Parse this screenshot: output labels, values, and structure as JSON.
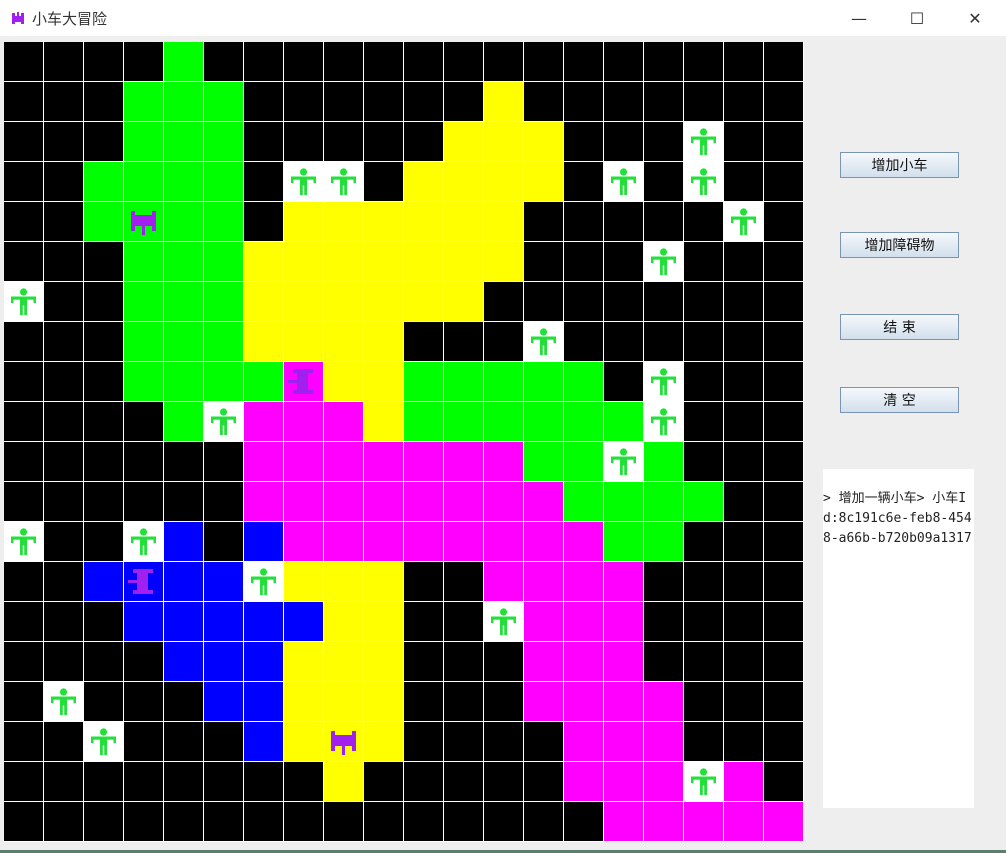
{
  "window": {
    "title": "小车大冒险",
    "controls": {
      "minimize": "—",
      "maximize": "☐",
      "close": "✕"
    }
  },
  "colors": {
    "K": "#000000",
    "G": "#00ff00",
    "Y": "#ffff00",
    "M": "#ff00ff",
    "B": "#0000ff",
    "W": "#ffffff",
    "person": "#22e03a",
    "car": "#a020f0"
  },
  "grid": {
    "rows": 20,
    "cols": 20,
    "cells": [
      "KKKKGKKKKKKKKKKKKKKK",
      "KKKGGGKKKKKKYKKKKKKK",
      "KKKGGGKKKKKYYYKKKPKK",
      "KKGGGGKPPKYYYYKPKPKK",
      "KKGCGGKYYYYYYKKKKKPK",
      "KKKGGGYYYYYYYKKKPKKK",
      "PKKGGGYYYYYYKKKKKKKK",
      "KKKGGGYYYYKKKPKKKKKK",
      "KKKGGGGCYYGGGGGKPKKK",
      "KKKKGPMMMYGGGGGGPKKK",
      "KKKKKKMMMMMMMGGPGKKK",
      "KKKKKKMMMMMMMMGGGGKK",
      "PKKPBKBMMMMMMMMGGKKK",
      "KKBCBBPYYYKKMMMMKKKK",
      "KKKBBBBBYYKKPMMMKKKK",
      "KKKKBBBYYYKKKMMMKKKK",
      "KPKKKBBYYYKKKMMMMKKK",
      "KKPKKKBYCYKKKKMMMKKK",
      "KKKKKKKKYKKKKKMMMPMK",
      "KKKKKKKKKKKKKKKMMMMM"
    ],
    "cars": [
      {
        "row": 4,
        "col": 3,
        "kind": "car-h"
      },
      {
        "row": 8,
        "col": 7,
        "kind": "car-v"
      },
      {
        "row": 13,
        "col": 3,
        "kind": "car-v"
      },
      {
        "row": 17,
        "col": 8,
        "kind": "car-h"
      }
    ]
  },
  "buttons": {
    "add_car": "增加小车",
    "add_obstacle": "增加障碍物",
    "end": "结  束",
    "clear": "清  空"
  },
  "log": {
    "text": "> 增加一辆小车> 小车Id:8c191c6e-feb8-4548-a66b-b720b09a1317"
  }
}
